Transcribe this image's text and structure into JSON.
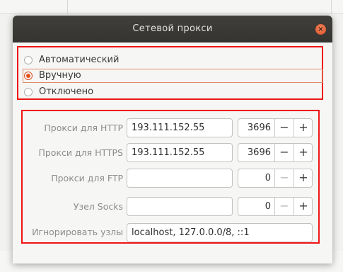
{
  "dialog": {
    "title": "Сетевой прокси",
    "close_glyph": "×"
  },
  "modes": [
    {
      "label": "Автоматический",
      "selected": false
    },
    {
      "label": "Вручную",
      "selected": true
    },
    {
      "label": "Отключено",
      "selected": false
    }
  ],
  "proxies": {
    "http": {
      "label": "Прокси для HTTP",
      "host": "193.111.152.55",
      "port": "3696"
    },
    "https": {
      "label": "Прокси для HTTPS",
      "host": "193.111.152.55",
      "port": "3696"
    },
    "ftp": {
      "label": "Прокси для FTP",
      "host": "",
      "port": "0"
    },
    "socks": {
      "label": "Узел Socks",
      "host": "",
      "port": "0"
    },
    "ignore": {
      "label": "Игнорировать узлы",
      "value": "localhost, 127.0.0.0/8, ::1"
    }
  },
  "spin": {
    "minus": "−",
    "plus": "+"
  },
  "colors": {
    "highlight_border": "#ee1515",
    "accent": "#e6531f",
    "titlebar": "#3a3935"
  }
}
